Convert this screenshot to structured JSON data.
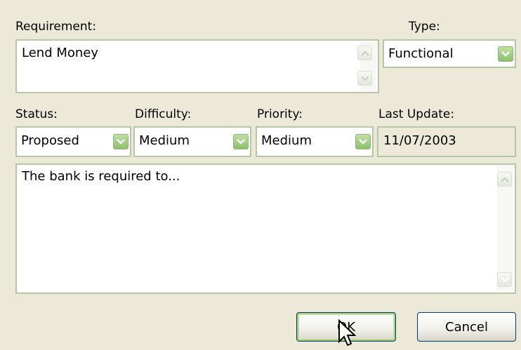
{
  "requirement": {
    "label": "Requirement:",
    "value": "Lend Money"
  },
  "type": {
    "label": "Type:",
    "selected": "Functional"
  },
  "status": {
    "label": "Status:",
    "selected": "Proposed"
  },
  "difficulty": {
    "label": "Difficulty:",
    "selected": "Medium"
  },
  "priority": {
    "label": "Priority:",
    "selected": "Medium"
  },
  "last_update": {
    "label": "Last Update:",
    "value": "11/07/2003"
  },
  "notes": {
    "value": "The bank is required to..."
  },
  "buttons": {
    "ok_label": "OK",
    "cancel_label": "Cancel"
  },
  "colors": {
    "dialog_bg": "#ECE9D8",
    "field_border": "#B7C6A5",
    "button_border": "#003C74"
  },
  "icons": {
    "dropdown": "chevron-down-icon",
    "scroll_up": "chevron-up-icon",
    "scroll_down": "chevron-down-icon",
    "cursor": "mouse-cursor-icon"
  }
}
